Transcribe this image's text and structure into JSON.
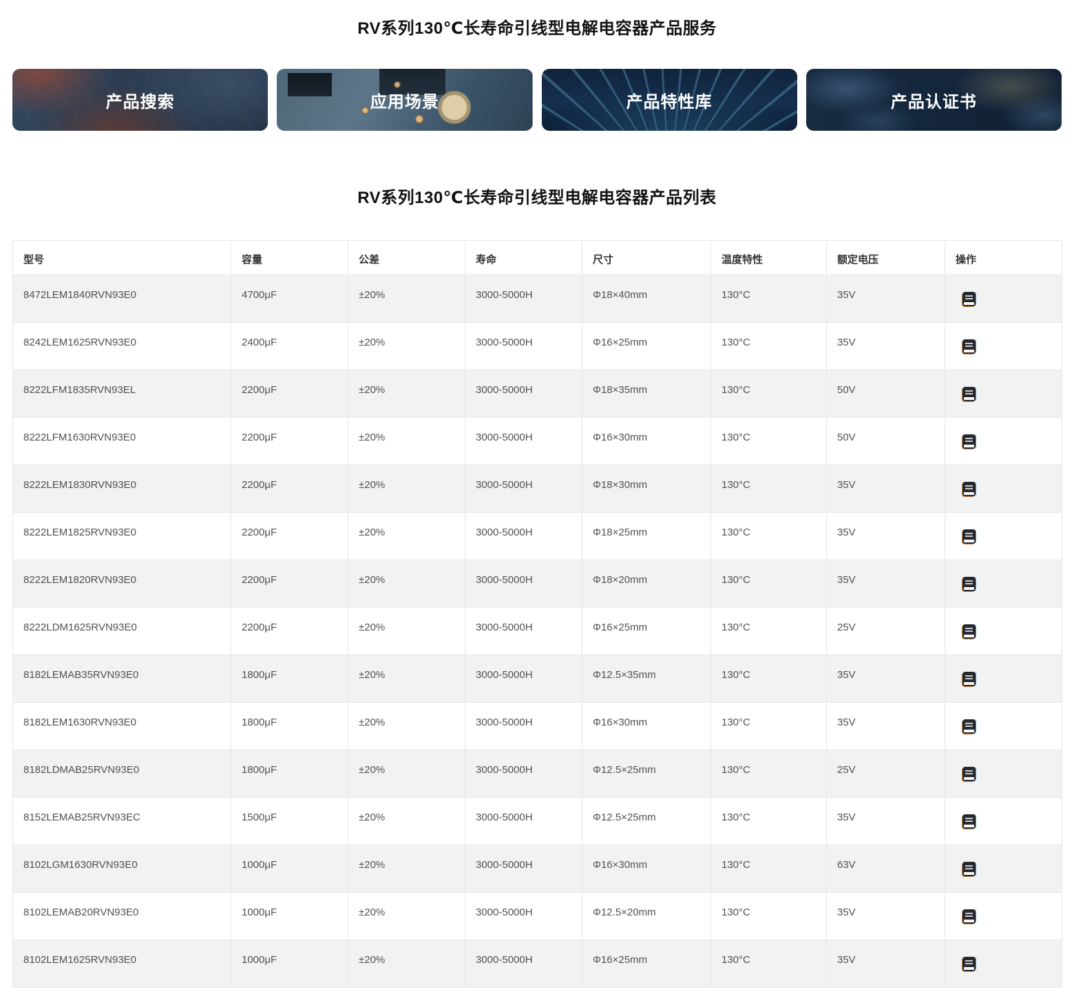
{
  "page": {
    "service_title": "RV系列130℃长寿命引线型电解电容器产品服务",
    "list_title": "RV系列130℃长寿命引线型电解电容器产品列表"
  },
  "banners": [
    {
      "label": "产品搜索",
      "background_theme": "dark-blurred-circuit-board-with-orange-glow"
    },
    {
      "label": "应用场景",
      "background_theme": "teal-circuit-board-with-chips-and-capacitor"
    },
    {
      "label": "产品特性库",
      "background_theme": "dark-navy-light-ray-streams"
    },
    {
      "label": "产品认证书",
      "background_theme": "dark-navy-world-map"
    }
  ],
  "table": {
    "columns": [
      "型号",
      "容量",
      "公差",
      "寿命",
      "尺寸",
      "温度特性",
      "额定电压",
      "操作"
    ],
    "operation_icon": "document-icon",
    "rows": [
      {
        "model": "8472LEM1840RVN93E0",
        "capacity": "4700μF",
        "tolerance": "±20%",
        "life": "3000-5000H",
        "size": "Φ18×40mm",
        "temp": "130°C",
        "voltage": "35V"
      },
      {
        "model": "8242LEM1625RVN93E0",
        "capacity": "2400μF",
        "tolerance": "±20%",
        "life": "3000-5000H",
        "size": "Φ16×25mm",
        "temp": "130°C",
        "voltage": "35V"
      },
      {
        "model": "8222LFM1835RVN93EL",
        "capacity": "2200μF",
        "tolerance": "±20%",
        "life": "3000-5000H",
        "size": "Φ18×35mm",
        "temp": "130°C",
        "voltage": "50V"
      },
      {
        "model": "8222LFM1630RVN93E0",
        "capacity": "2200μF",
        "tolerance": "±20%",
        "life": "3000-5000H",
        "size": "Φ16×30mm",
        "temp": "130°C",
        "voltage": "50V"
      },
      {
        "model": "8222LEM1830RVN93E0",
        "capacity": "2200μF",
        "tolerance": "±20%",
        "life": "3000-5000H",
        "size": "Φ18×30mm",
        "temp": "130°C",
        "voltage": "35V"
      },
      {
        "model": "8222LEM1825RVN93E0",
        "capacity": "2200μF",
        "tolerance": "±20%",
        "life": "3000-5000H",
        "size": "Φ18×25mm",
        "temp": "130°C",
        "voltage": "35V"
      },
      {
        "model": "8222LEM1820RVN93E0",
        "capacity": "2200μF",
        "tolerance": "±20%",
        "life": "3000-5000H",
        "size": "Φ18×20mm",
        "temp": "130°C",
        "voltage": "35V"
      },
      {
        "model": "8222LDM1625RVN93E0",
        "capacity": "2200μF",
        "tolerance": "±20%",
        "life": "3000-5000H",
        "size": "Φ16×25mm",
        "temp": "130°C",
        "voltage": "25V"
      },
      {
        "model": "8182LEMAB35RVN93E0",
        "capacity": "1800μF",
        "tolerance": "±20%",
        "life": "3000-5000H",
        "size": "Φ12.5×35mm",
        "temp": "130°C",
        "voltage": "35V"
      },
      {
        "model": "8182LEM1630RVN93E0",
        "capacity": "1800μF",
        "tolerance": "±20%",
        "life": "3000-5000H",
        "size": "Φ16×30mm",
        "temp": "130°C",
        "voltage": "35V"
      },
      {
        "model": "8182LDMAB25RVN93E0",
        "capacity": "1800μF",
        "tolerance": "±20%",
        "life": "3000-5000H",
        "size": "Φ12.5×25mm",
        "temp": "130°C",
        "voltage": "25V"
      },
      {
        "model": "8152LEMAB25RVN93EC",
        "capacity": "1500μF",
        "tolerance": "±20%",
        "life": "3000-5000H",
        "size": "Φ12.5×25mm",
        "temp": "130°C",
        "voltage": "35V"
      },
      {
        "model": "8102LGM1630RVN93E0",
        "capacity": "1000μF",
        "tolerance": "±20%",
        "life": "3000-5000H",
        "size": "Φ16×30mm",
        "temp": "130°C",
        "voltage": "63V"
      },
      {
        "model": "8102LEMAB20RVN93E0",
        "capacity": "1000μF",
        "tolerance": "±20%",
        "life": "3000-5000H",
        "size": "Φ12.5×20mm",
        "temp": "130°C",
        "voltage": "35V"
      },
      {
        "model": "8102LEM1625RVN93E0",
        "capacity": "1000μF",
        "tolerance": "±20%",
        "life": "3000-5000H",
        "size": "Φ16×25mm",
        "temp": "130°C",
        "voltage": "35V"
      }
    ]
  },
  "colors": {
    "alt_row_bg": "#f2f2f2",
    "table_border": "#e6e6e6",
    "banner_text": "#ffffff",
    "title_text": "#111111",
    "cell_text": "#515151"
  }
}
